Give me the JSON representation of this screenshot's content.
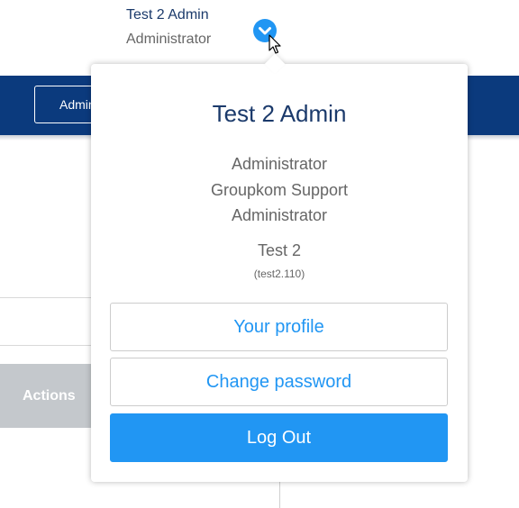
{
  "user": {
    "name": "Test 2 Admin",
    "role": "Administrator",
    "toggle_icon": "chevron-down-circle-icon"
  },
  "navbar": {
    "admin_button_label": "Administration",
    "color": "#0b3a7d"
  },
  "table": {
    "actions_header": "Actions"
  },
  "dropdown": {
    "name": "Test 2 Admin",
    "role": "Administrator",
    "group": "Groupkom Support",
    "group_role": "Administrator",
    "organization": "Test 2",
    "organization_code": "(test2.110)",
    "profile_button": "Your profile",
    "password_button": "Change password",
    "logout_button": "Log Out",
    "accent_color": "#2196f3"
  }
}
